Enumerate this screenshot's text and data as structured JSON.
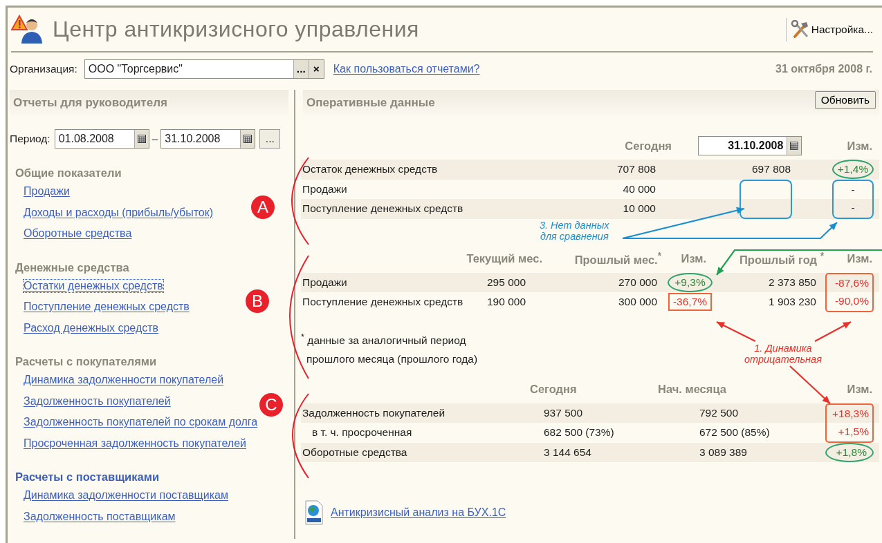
{
  "window": {
    "title": "Центр антикризисного управления",
    "settings_button": "Настройка..."
  },
  "organization": {
    "label": "Организация:",
    "value": "ООО \"Торгсервис\"",
    "select_button": "...",
    "clear_button": "×"
  },
  "help_link": "Как пользоваться отчетами?",
  "current_date": "31 октября 2008 г.",
  "reports": {
    "title": "Отчеты для руководителя",
    "period_label": "Период:",
    "period_from": "01.08.2008",
    "period_separator": "–",
    "period_to": "31.10.2008",
    "period_button": "...",
    "groups": [
      {
        "title": "Общие показатели",
        "active": false,
        "links": [
          {
            "label": "Продажи",
            "focused": false
          },
          {
            "label": "Доходы и расходы (прибыль/убыток)",
            "focused": false
          },
          {
            "label": "Оборотные средства",
            "focused": false
          }
        ]
      },
      {
        "title": "Денежные средства",
        "active": false,
        "links": [
          {
            "label": "Остатки денежных средств",
            "focused": true
          },
          {
            "label": "Поступление денежных средств",
            "focused": false
          },
          {
            "label": "Расход денежных средств",
            "focused": false
          }
        ]
      },
      {
        "title": "Расчеты с покупателями",
        "active": false,
        "links": [
          {
            "label": "Динамика задолженности покупателей",
            "focused": false
          },
          {
            "label": "Задолженность покупателей",
            "focused": false
          },
          {
            "label": "Задолженность покупателей по срокам долга",
            "focused": false
          },
          {
            "label": "Просроченная задолженность покупателей",
            "focused": false
          }
        ]
      },
      {
        "title": "Расчеты с поставщиками",
        "active": true,
        "links": [
          {
            "label": "Динамика задолженности поставщикам",
            "focused": false
          },
          {
            "label": "Задолженность поставщикам",
            "focused": false
          }
        ]
      }
    ]
  },
  "operational": {
    "title": "Оперативные данные",
    "refresh_button": "Обновить",
    "sections": [
      {
        "badge": "A",
        "columns": [
          {
            "kind": "blank"
          },
          {
            "kind": "header",
            "text": "Сегодня"
          },
          {
            "kind": "date",
            "text": "31.10.2008"
          },
          {
            "kind": "header",
            "text": "Изм."
          }
        ],
        "rows": [
          {
            "cells": [
              {
                "text": "Остаток денежных средств"
              },
              {
                "text": "707 808"
              },
              {
                "text": "697 808"
              },
              {
                "text": "+1,4%",
                "kind": "positive",
                "callout": {
                  "kind": "circle",
                  "color": "#2ea36b"
                }
              }
            ]
          },
          {
            "cells": [
              {
                "text": "Продажи"
              },
              {
                "text": "40 000"
              },
              {
                "callout": {
                  "kind": "box_start",
                  "color": "#2a9ad6"
                }
              },
              {
                "text": "-",
                "kind": "neutral",
                "callout": {
                  "kind": "box_start",
                  "color": "#2a9ad6"
                }
              }
            ]
          },
          {
            "cells": [
              {
                "text": "Поступление денежных средств"
              },
              {
                "text": "10 000"
              },
              {
                "callout": {
                  "kind": "box_end",
                  "color": "#2a9ad6"
                }
              },
              {
                "text": "-",
                "kind": "neutral",
                "callout": {
                  "kind": "box_end",
                  "color": "#2a9ad6"
                }
              }
            ]
          }
        ]
      },
      {
        "badge": "B",
        "columns": [
          {
            "kind": "blank"
          },
          {
            "kind": "header",
            "text": "Текущий мес."
          },
          {
            "kind": "header",
            "text": "Прошлый мес.$^{*}$"
          },
          {
            "kind": "header",
            "text": "Изм."
          },
          {
            "kind": "header",
            "text": "Прошлый год $^{*}$"
          },
          {
            "kind": "header",
            "text": "Изм."
          }
        ],
        "rows": [
          {
            "cells": [
              {
                "text": "Продажи"
              },
              {
                "text": "295 000"
              },
              {
                "text": "270 000"
              },
              {
                "text": "+9,3%",
                "kind": "positive",
                "callout": {
                  "kind": "circle",
                  "color": "#2ea36b"
                }
              },
              {
                "text": "2 373 850"
              },
              {
                "text": "-87,6%",
                "kind": "negative",
                "callout": {
                  "kind": "box_start",
                  "color": "#f0643c"
                }
              }
            ]
          },
          {
            "cells": [
              {
                "text": "Поступление денежных средств"
              },
              {
                "text": "190 000"
              },
              {
                "text": "300 000"
              },
              {
                "text": "-36,7%",
                "kind": "negative",
                "callout": {
                  "kind": "box",
                  "color": "#f0643c"
                }
              },
              {
                "text": "1 903 230"
              },
              {
                "text": "-90,0%",
                "kind": "negative",
                "callout": {
                  "kind": "box_end",
                  "color": "#f0643c"
                }
              }
            ]
          }
        ],
        "note_lines": [
          "$^{*}$ данные за аналогичный период",
          "прошлого месяца (прошлого года)"
        ]
      },
      {
        "badge": "C",
        "columns": [
          {
            "kind": "blank"
          },
          {
            "kind": "header",
            "text": "Сегодня"
          },
          {
            "kind": "header",
            "text": "Нач. месяца"
          },
          {
            "kind": "header",
            "text": "Изм."
          }
        ],
        "rows": [
          {
            "cells": [
              {
                "text": "Задолженность покупателей"
              },
              {
                "text": "937 500"
              },
              {
                "text": "792 500"
              },
              {
                "text": "+18,3%",
                "kind": "negative",
                "callout": {
                  "kind": "box_start",
                  "color": "#f0643c"
                }
              }
            ],
            "children": [
              {
                "cells": [
                  {
                    "text": "в т. ч. просроченная"
                  },
                  {
                    "text": "682 500 (73%)"
                  },
                  {
                    "text": "672 500 (85%)"
                  },
                  {
                    "text": "+1,5%",
                    "kind": "negative",
                    "callout": {
                      "kind": "box_end",
                      "color": "#f0643c"
                    }
                  }
                ]
              }
            ]
          },
          {
            "cells": [
              {
                "text": "Оборотные средства"
              },
              {
                "text": "3 144 654"
              },
              {
                "text": "3 089 389"
              },
              {
                "text": "+1,8%",
                "kind": "positive",
                "callout": {
                  "kind": "circle",
                  "color": "#2ea36b"
                }
              }
            ]
          }
        ]
      }
    ],
    "web_link": "Антикризисный анализ на БУХ.1С"
  },
  "annotations": [
    {
      "lines": [
        "3. Нет данных",
        "для сравнения"
      ],
      "color": "#1a8fd0"
    },
    {
      "lines": [
        "1. Динамика",
        "отрицательная"
      ],
      "color": "#e8312b"
    }
  ]
}
